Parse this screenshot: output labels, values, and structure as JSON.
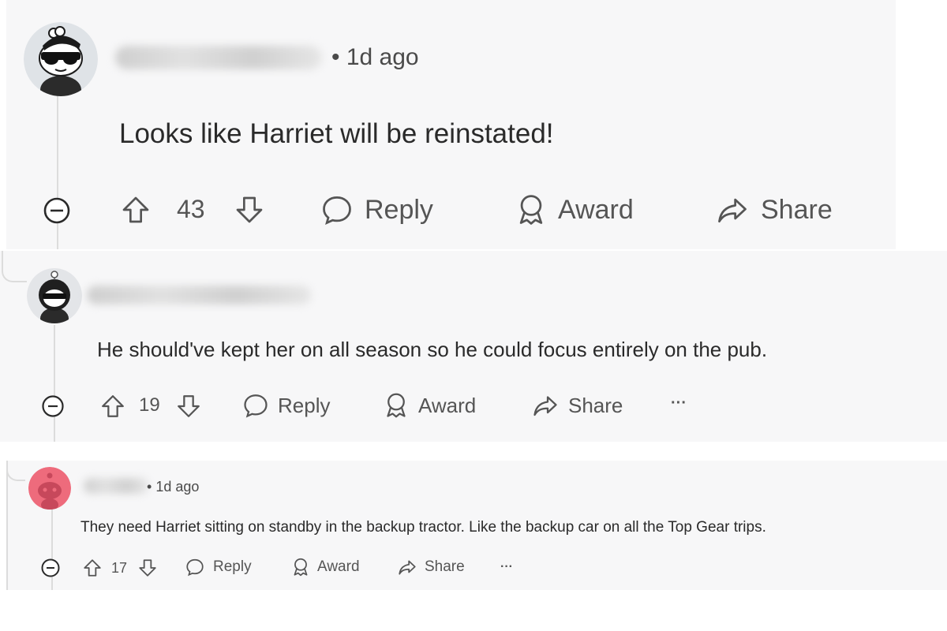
{
  "comments": [
    {
      "timestamp": "1d ago",
      "text": "Looks like Harriet will be reinstated!",
      "votes": "43",
      "actions": {
        "reply": "Reply",
        "award": "Award",
        "share": "Share"
      }
    },
    {
      "text": "He should've kept her on all season so he could focus entirely on the pub.",
      "votes": "19",
      "actions": {
        "reply": "Reply",
        "award": "Award",
        "share": "Share",
        "more": "···"
      }
    },
    {
      "timestamp": "1d ago",
      "text": "They need Harriet sitting on standby in the backup tractor. Like the backup car on all the Top Gear trips.",
      "votes": "17",
      "actions": {
        "reply": "Reply",
        "award": "Award",
        "share": "Share",
        "more": "···"
      }
    }
  ],
  "colors": {
    "panel": "#f7f7f8",
    "text": "#2a2a2a",
    "muted": "#555555",
    "avatar3": "#ee6b7c"
  },
  "icons": [
    "collapse-icon",
    "upvote-icon",
    "downvote-icon",
    "reply-icon",
    "award-icon",
    "share-icon"
  ]
}
